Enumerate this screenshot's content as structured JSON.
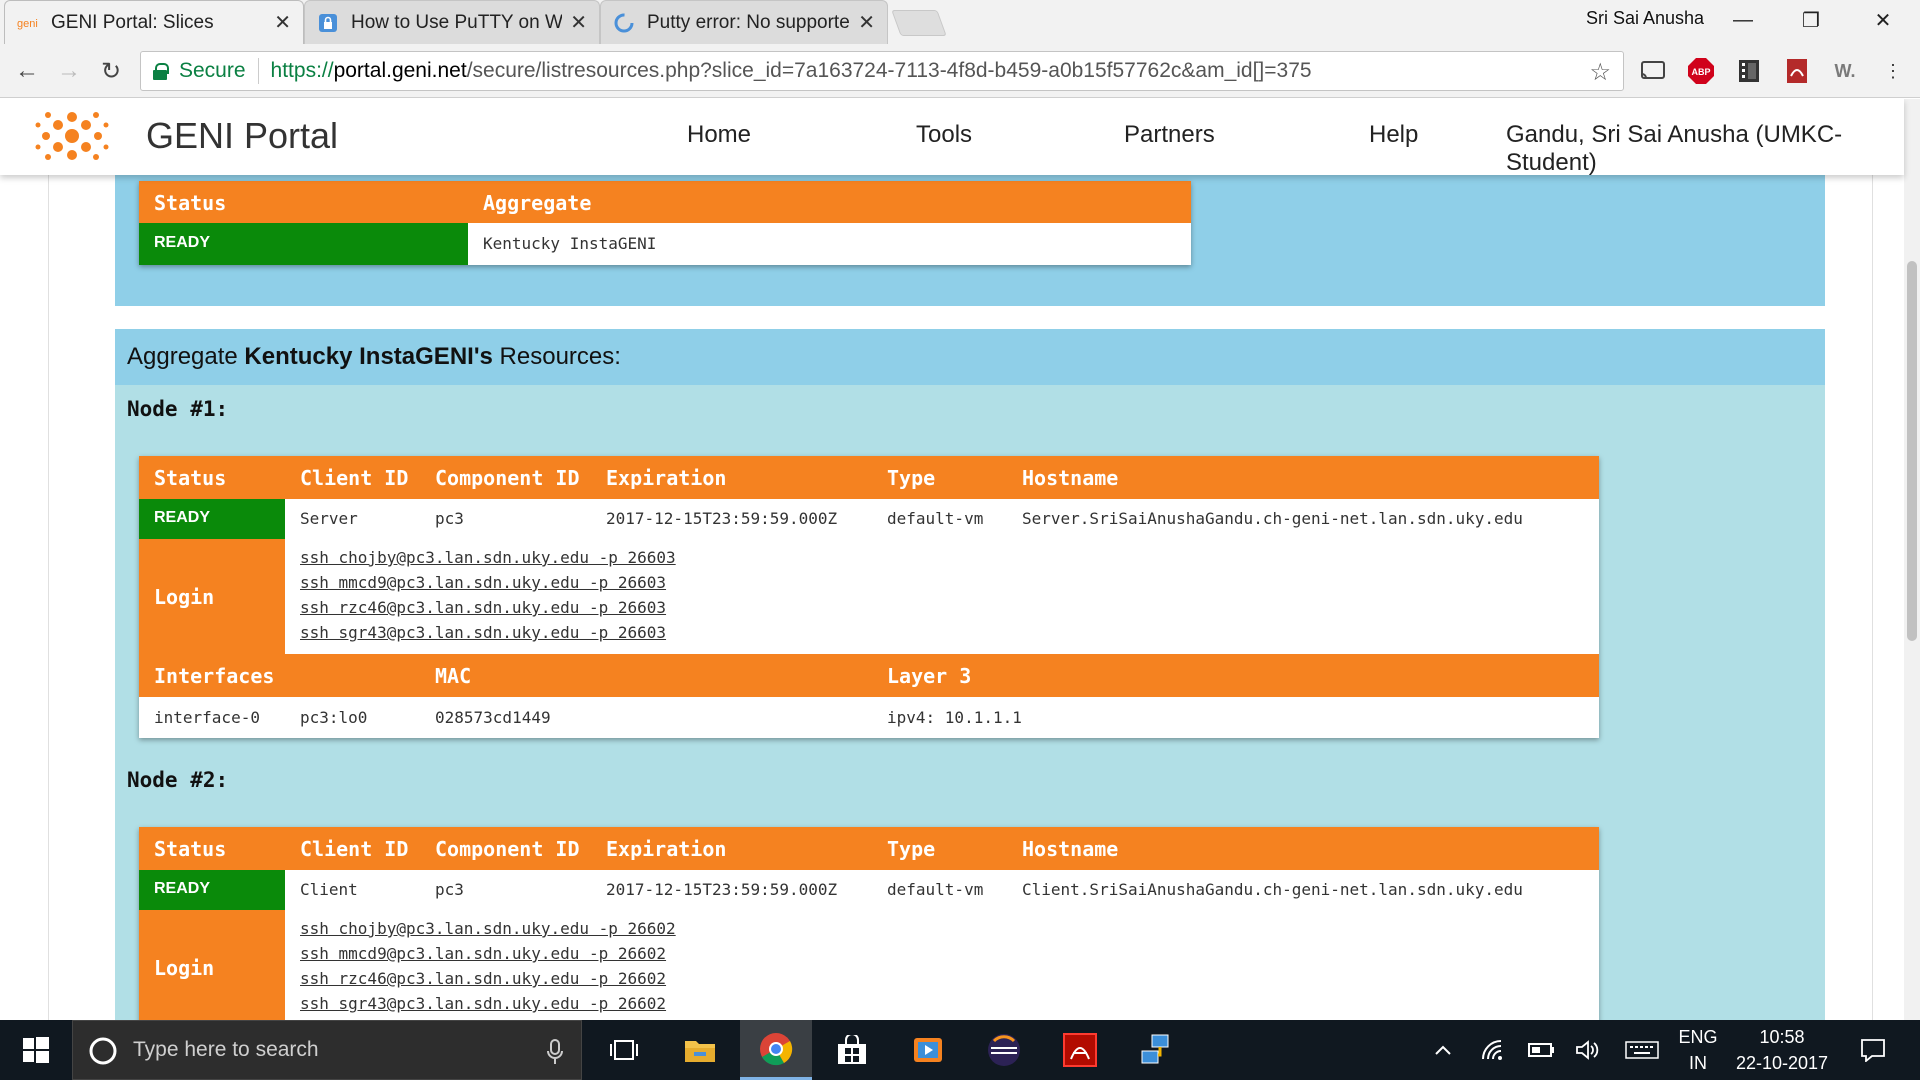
{
  "browser": {
    "tabs": [
      {
        "title": "GENI Portal: Slices",
        "favicon": "geni-icon",
        "active": true
      },
      {
        "title": "How to Use PuTTY on Wi",
        "favicon": "lock-icon",
        "active": false
      },
      {
        "title": "Putty error: No supporte",
        "favicon": "loading-icon",
        "active": false
      }
    ],
    "profile_name": "Sri Sai Anusha",
    "secure_label": "Secure",
    "url_scheme": "https://",
    "url_host": "portal.geni.net",
    "url_path": "/secure/listresources.php?slice_id=7a163724-7113-4f8d-b459-a0b15f57762c&am_id[]=375",
    "extensions": [
      "cast-icon",
      "adblock-icon",
      "film-icon",
      "pdf-icon",
      "w-icon",
      "menu-icon"
    ],
    "adblock_label": "ABP",
    "w_label": "W."
  },
  "portal": {
    "brand": "GENI Portal",
    "nav": [
      "Home",
      "Tools",
      "Partners",
      "Help"
    ],
    "user": "Gandu, Sri Sai Anusha (UMKC-Student)"
  },
  "status_table": {
    "headers": [
      "Status",
      "Aggregate"
    ],
    "status": "READY",
    "aggregate": "Kentucky InstaGENI"
  },
  "aggregate_section": {
    "prefix": "Aggregate ",
    "name": "Kentucky InstaGENI's",
    "suffix": " Resources:"
  },
  "nodes": [
    {
      "heading": "Node #1:",
      "headers": [
        "Status",
        "Client ID",
        "Component ID",
        "Expiration",
        "Type",
        "Hostname"
      ],
      "status": "READY",
      "client_id": "Server",
      "component_id": "pc3",
      "expiration": "2017-12-15T23:59:59.000Z",
      "type": "default-vm",
      "hostname": "Server.SriSaiAnushaGandu.ch-geni-net.lan.sdn.uky.edu",
      "login_label": "Login",
      "logins": [
        "ssh chojby@pc3.lan.sdn.uky.edu -p 26603",
        "ssh mmcd9@pc3.lan.sdn.uky.edu -p 26603",
        "ssh rzc46@pc3.lan.sdn.uky.edu -p 26603",
        "ssh sgr43@pc3.lan.sdn.uky.edu -p 26603"
      ],
      "iface_headers": [
        "Interfaces",
        "MAC",
        "Layer 3"
      ],
      "iface": {
        "name": "interface-0",
        "client": "pc3:lo0",
        "mac": "028573cd1449",
        "layer3": "ipv4: 10.1.1.1"
      }
    },
    {
      "heading": "Node #2:",
      "headers": [
        "Status",
        "Client ID",
        "Component ID",
        "Expiration",
        "Type",
        "Hostname"
      ],
      "status": "READY",
      "client_id": "Client",
      "component_id": "pc3",
      "expiration": "2017-12-15T23:59:59.000Z",
      "type": "default-vm",
      "hostname": "Client.SriSaiAnushaGandu.ch-geni-net.lan.sdn.uky.edu",
      "login_label": "Login",
      "logins": [
        "ssh chojby@pc3.lan.sdn.uky.edu -p 26602",
        "ssh mmcd9@pc3.lan.sdn.uky.edu -p 26602",
        "ssh rzc46@pc3.lan.sdn.uky.edu -p 26602",
        "ssh sgr43@pc3.lan.sdn.uky.edu -p 26602"
      ]
    }
  ],
  "taskbar": {
    "search_placeholder": "Type here to search",
    "apps": [
      "task-view-icon",
      "file-explorer-icon",
      "chrome-icon",
      "store-icon",
      "media-player-icon",
      "eclipse-icon",
      "acrobat-icon",
      "network-app-icon"
    ],
    "lang_top": "ENG",
    "lang_bottom": "IN",
    "time": "10:58",
    "date": "22-10-2017"
  },
  "colors": {
    "orange": "#f58220",
    "green": "#0a8a0a",
    "panel_blue": "#8fcfe8",
    "panel_teal": "#b1dfe6"
  }
}
